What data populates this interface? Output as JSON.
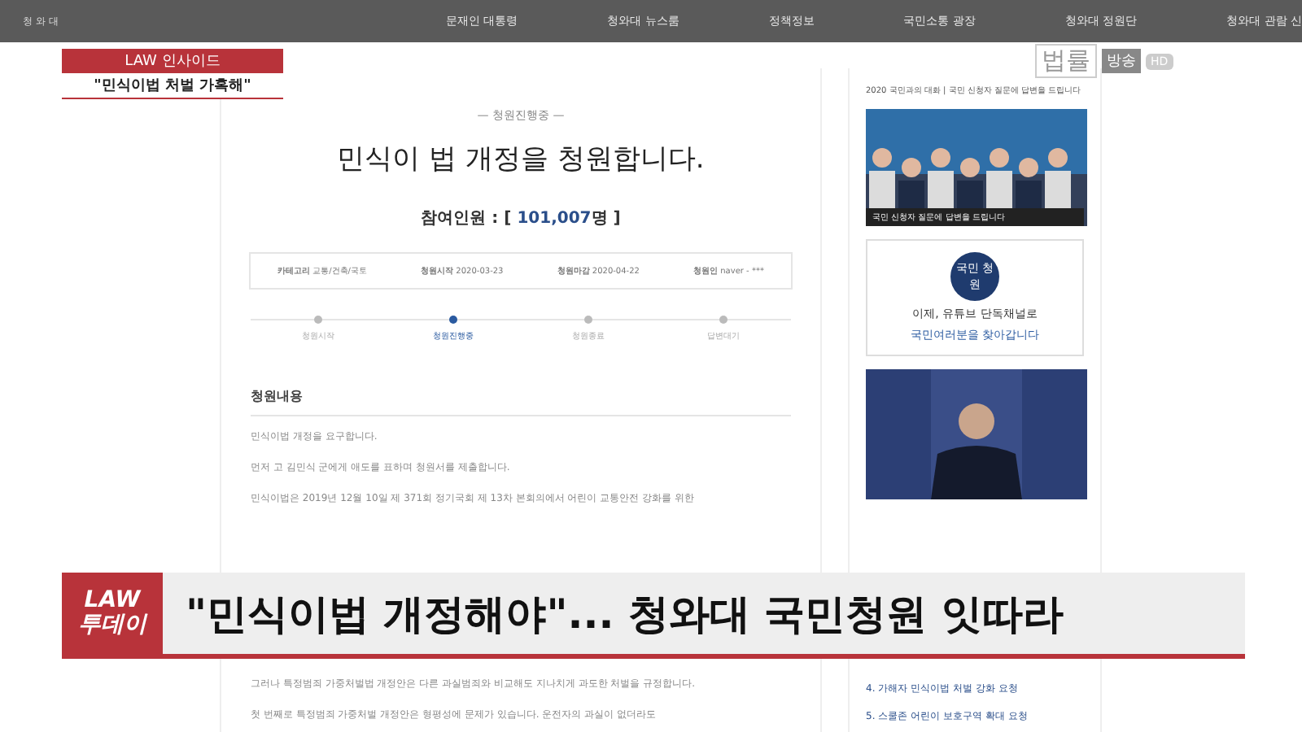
{
  "site_nav": {
    "logo": "청 와 대",
    "items": [
      "문재인 대통령",
      "청와대 뉴스룸",
      "정책정보",
      "국민소통 광장",
      "청와대 정원단",
      "청와대 관람 신"
    ]
  },
  "petition": {
    "status": "— 청원진행중 —",
    "title": "민식이 법 개정을 청원합니다.",
    "count_label": "참여인원 : [",
    "count": "101,007",
    "count_unit": "명 ]",
    "meta": [
      {
        "label": "카테고리",
        "value": "교통/건축/국토"
      },
      {
        "label": "청원시작",
        "value": "2020-03-23"
      },
      {
        "label": "청원마감",
        "value": "2020-04-22"
      },
      {
        "label": "청원인",
        "value": "naver - ***"
      }
    ],
    "steps": [
      {
        "label": "청원시작",
        "selected": false
      },
      {
        "label": "청원진행중",
        "selected": true
      },
      {
        "label": "청원종료",
        "selected": false
      },
      {
        "label": "답변대기",
        "selected": false
      }
    ],
    "content_heading": "청원내용",
    "paragraphs": [
      "민식이법 개정을 요구합니다.",
      "먼저 고 김민식 군에게 애도를 표하며 청원서를 제출합니다.",
      "민식이법은 2019년 12월 10일 제 371회 정기국회 제 13차 본회의에서 어린이 교통안전 강화를 위한",
      "그러나 특정범죄 가중처벌법 개정안은 다른 과실범죄와 비교해도 지나치게 과도한 처벌을 규정합니다.",
      "첫 번째로 특정범죄 가중처벌 개정안은 형평성에 문제가 있습니다. 운전자의 과실이 없더라도"
    ]
  },
  "sidebar": {
    "caption": "2020 국민과의 대화 | 국민 신청자 질문에 답변을 드립니다",
    "photo_caption": "국민 신청자 질문에 답변을 드립니다",
    "banner_logo": "국민 청원",
    "banner_line1": "이제, 유튜브 단독채널로",
    "banner_line2": "국민여러분을 찾아갑니다",
    "list": [
      "4. 가해자 민식이법 처벌 강화 요청",
      "5. 스쿨존 어린이 보호구역 확대 요청"
    ]
  },
  "overlay": {
    "segment_tag": "LAW 인사이드",
    "segment_quote": "\"민식이법 처벌 가혹해\"",
    "channel_name": "법률",
    "channel_tag": "방송",
    "quality": "HD",
    "program_line1": "LAW",
    "program_line2": "투데이",
    "headline": "\"민식이법 개정해야\"... 청와대 국민청원 잇따라"
  }
}
